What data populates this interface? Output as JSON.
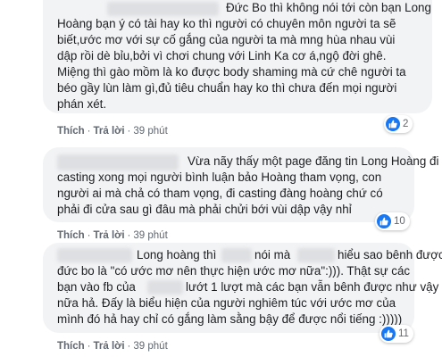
{
  "comments": [
    {
      "lines": [
        "Đức Bo thì không nói tới còn bạn Long",
        "Hoàng bạn ý có tài hay ko thì người có chuyên môn người ta sẽ",
        "biết,ước mơ với sự cố gắng của người ta mà mng hùa nhau vùi",
        "dập rồi dè bỉu,bởi vì chơi chung với Linh Ka cơ á,ngộ đời ghê.",
        "Miệng thì gào mồm là ko được body shaming mà cứ chê người ta",
        "béo gầy lùn làm gì,đủ tiêu chuẩn hay ko thì chưa đến mọi người",
        "phán xét."
      ],
      "actions": {
        "like": "Thích",
        "reply": "Trả lời",
        "time": "39 phút"
      },
      "reaction_count": "2",
      "reaction_icon": "like-icon"
    },
    {
      "lines": [
        "Vừa nãy thấy một page đăng tin Long Hoàng đi",
        "casting xong mọi người bình luận bảo Hoàng tham vọng, con",
        "người ai mà chả có tham vọng, đi casting đàng hoàng chứ có",
        "phải đi cửa sau gì đâu mà phải chửi bới vùi dập vậy nhỉ"
      ],
      "actions": {
        "like": "Thích",
        "reply": "Trả lời",
        "time": "39 phút"
      },
      "reaction_count": "10",
      "reaction_icon": "like-icon"
    },
    {
      "lines": [
        "Long hoàng thì",
        "nói mà",
        "hiểu sao bênh được",
        "đức bo là \"có ước mơ nên thực hiện ước mơ nữa\":))).  Thật sự các",
        "bạn vào fb của",
        "lướt 1 lượt mà các bạn vẫn bênh được như vậy",
        "nữa hả. Đấy là biểu hiện của người nghiêm túc với ước mơ của",
        "mình đó hả hay chỉ có gắng làm sằng bậy để được nổi tiếng :)))))"
      ],
      "actions": {
        "like": "Thích",
        "reply": "Trả lời",
        "time": "39 phút"
      },
      "reaction_count": "11",
      "reaction_icon": "like-icon"
    }
  ],
  "colors": {
    "bubble": "#f2f3f5",
    "like_blue": "#1877f2",
    "meta_gray": "#606770"
  }
}
